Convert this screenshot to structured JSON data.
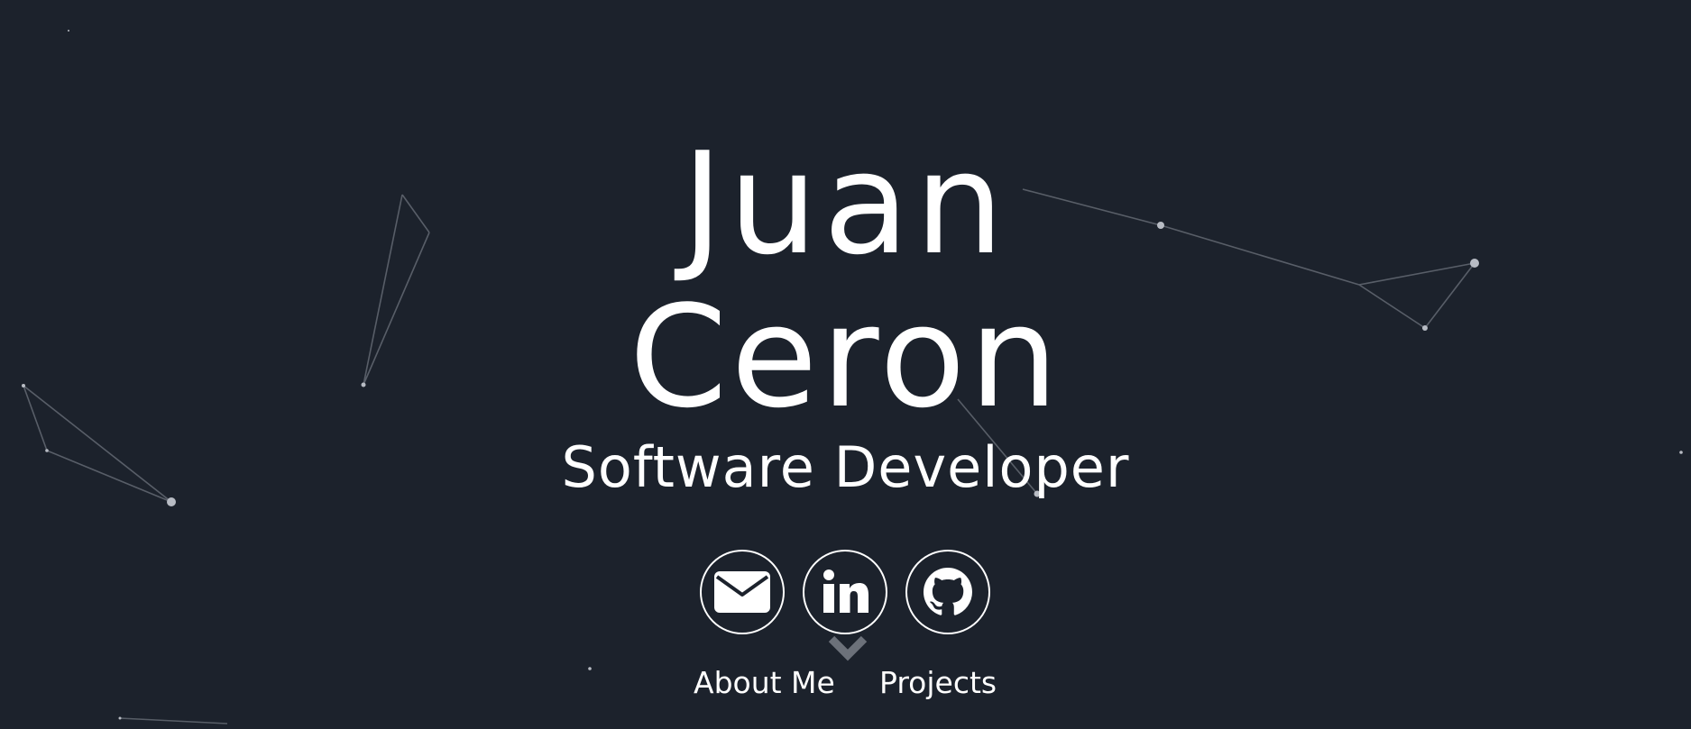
{
  "colors": {
    "background": "#1c222c",
    "foreground": "#ffffff",
    "particle": "#8a8f99"
  },
  "hero": {
    "first_name": "Juan",
    "last_name": "Ceron",
    "subtitle": "Software Developer"
  },
  "socials": [
    {
      "icon": "envelope-icon"
    },
    {
      "icon": "linkedin-icon"
    },
    {
      "icon": "github-icon"
    }
  ],
  "scroll_indicator": {
    "icon": "chevron-down-icon"
  },
  "nav": {
    "about_label": "About Me",
    "projects_label": "Projects"
  }
}
